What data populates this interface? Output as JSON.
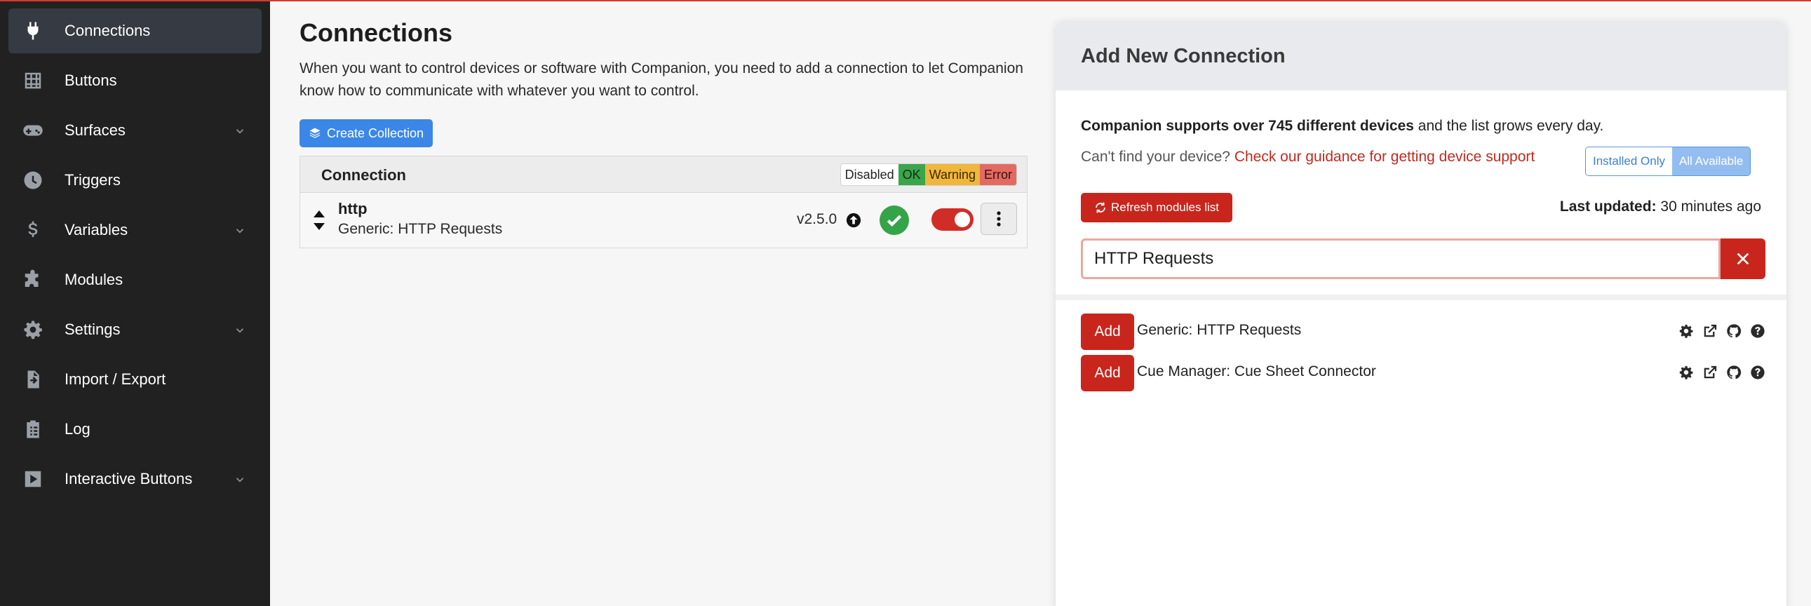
{
  "sidebar": {
    "items": [
      {
        "label": "Connections",
        "icon": "plug-icon",
        "active": true,
        "has_chevron": false
      },
      {
        "label": "Buttons",
        "icon": "grid-icon",
        "active": false,
        "has_chevron": false
      },
      {
        "label": "Surfaces",
        "icon": "gamepad-icon",
        "active": false,
        "has_chevron": true
      },
      {
        "label": "Triggers",
        "icon": "clock-icon",
        "active": false,
        "has_chevron": false
      },
      {
        "label": "Variables",
        "icon": "dollar-icon",
        "active": false,
        "has_chevron": true
      },
      {
        "label": "Modules",
        "icon": "puzzle-icon",
        "active": false,
        "has_chevron": false
      },
      {
        "label": "Settings",
        "icon": "gear-icon",
        "active": false,
        "has_chevron": true
      },
      {
        "label": "Import / Export",
        "icon": "file-import-icon",
        "active": false,
        "has_chevron": false
      },
      {
        "label": "Log",
        "icon": "clipboard-list-icon",
        "active": false,
        "has_chevron": false
      },
      {
        "label": "Interactive Buttons",
        "icon": "play-square-icon",
        "active": false,
        "has_chevron": true
      }
    ]
  },
  "main": {
    "title": "Connections",
    "intro": "When you want to control devices or software with Companion, you need to add a connection to let Companion know how to communicate with whatever you want to control.",
    "create_collection_label": "Create Collection",
    "table": {
      "header": "Connection",
      "legend": {
        "disabled": "Disabled",
        "ok": "OK",
        "warning": "Warning",
        "error": "Error"
      },
      "rows": [
        {
          "name": "http",
          "module": "Generic: HTTP Requests",
          "version": "v2.5.0",
          "status": "ok",
          "enabled": true
        }
      ]
    }
  },
  "panel": {
    "title": "Add New Connection",
    "support_bold": "Companion supports over 745 different devices",
    "support_rest": " and the list grows every day.",
    "help_text": "Can't find your device? ",
    "help_link": "Check our guidance for getting device support",
    "filter": {
      "installed_only": "Installed Only",
      "all_available": "All Available",
      "selected": "All Available"
    },
    "refresh_label": "Refresh modules list",
    "last_updated_label": "Last updated:",
    "last_updated_value": " 30 minutes ago",
    "search": {
      "value": "HTTP Requests"
    },
    "results": [
      {
        "add_label": "Add",
        "name": "Generic: HTTP Requests"
      },
      {
        "add_label": "Add",
        "name": "Cue Manager: Cue Sheet Connector"
      }
    ]
  },
  "colors": {
    "accent_red": "#c8261d",
    "accent_blue": "#3b87e8",
    "sidebar_bg": "#212121",
    "ok_green": "#34a448"
  }
}
